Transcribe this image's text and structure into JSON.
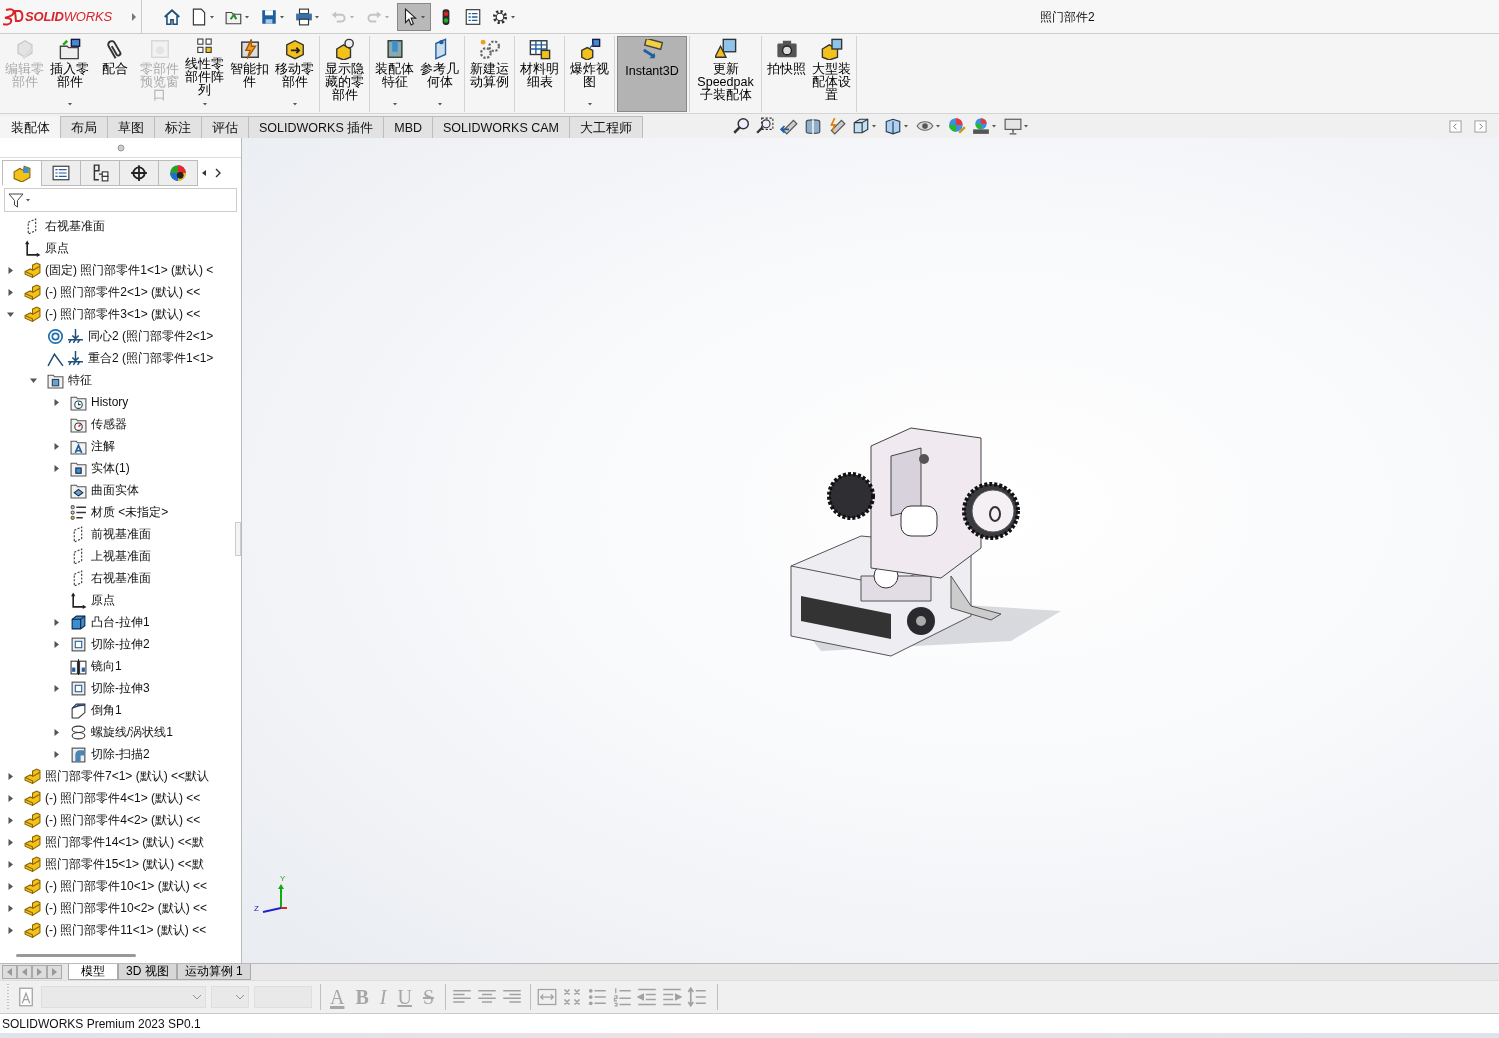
{
  "app": {
    "logo": "**SOLID**WORKS"
  },
  "window": {
    "title": "照门部件2"
  },
  "quick_toolbar": [
    {
      "kind": "home",
      "dropdown": false,
      "disabled": false,
      "selected": false
    },
    {
      "kind": "new",
      "dropdown": true,
      "disabled": false,
      "selected": false
    },
    {
      "kind": "open",
      "dropdown": true,
      "disabled": false,
      "selected": false
    },
    {
      "kind": "save",
      "dropdown": true,
      "disabled": false,
      "selected": false
    },
    {
      "kind": "print",
      "dropdown": true,
      "disabled": false,
      "selected": false
    },
    {
      "kind": "undo",
      "dropdown": true,
      "disabled": true,
      "selected": false
    },
    {
      "kind": "redo",
      "dropdown": true,
      "disabled": true,
      "selected": false
    },
    {
      "kind": "select",
      "dropdown": true,
      "disabled": false,
      "selected": true
    },
    {
      "kind": "rebuild",
      "dropdown": false,
      "disabled": false,
      "selected": false
    },
    {
      "kind": "file_props",
      "dropdown": false,
      "disabled": false,
      "selected": false
    },
    {
      "kind": "options",
      "dropdown": true,
      "disabled": false,
      "selected": false
    }
  ],
  "ribbon": [
    {
      "buttons": [
        {
          "kind": "edit_part",
          "label": "编辑零部件",
          "disabled": true,
          "dropdown": false,
          "selected": false
        },
        {
          "kind": "insert_part",
          "label": "插入零部件",
          "disabled": false,
          "dropdown": true,
          "selected": false
        },
        {
          "kind": "mate",
          "label": "配合",
          "disabled": false,
          "dropdown": false,
          "selected": false
        },
        {
          "kind": "preview",
          "label": "零部件预览窗口",
          "disabled": true,
          "dropdown": false,
          "selected": false
        },
        {
          "kind": "pattern",
          "label": "线性零部件阵列",
          "disabled": false,
          "dropdown": true,
          "selected": false
        },
        {
          "kind": "fastener",
          "label": "智能扣件",
          "disabled": false,
          "dropdown": false,
          "selected": false
        },
        {
          "kind": "move",
          "label": "移动零部件",
          "disabled": false,
          "dropdown": true,
          "selected": false
        }
      ]
    },
    {
      "buttons": [
        {
          "kind": "show_hidden",
          "label": "显示隐藏的零部件",
          "disabled": false,
          "dropdown": false,
          "selected": false
        }
      ]
    },
    {
      "buttons": [
        {
          "kind": "asm_feature",
          "label": "装配体特征",
          "disabled": false,
          "dropdown": true,
          "selected": false
        },
        {
          "kind": "ref_geom",
          "label": "参考几何体",
          "disabled": false,
          "dropdown": true,
          "selected": false
        }
      ]
    },
    {
      "buttons": [
        {
          "kind": "motion",
          "label": "新建运动算例",
          "disabled": false,
          "dropdown": false,
          "selected": false
        }
      ]
    },
    {
      "buttons": [
        {
          "kind": "bom",
          "label": "材料明细表",
          "disabled": false,
          "dropdown": false,
          "selected": false
        }
      ]
    },
    {
      "buttons": [
        {
          "kind": "explode",
          "label": "爆炸视图",
          "disabled": false,
          "dropdown": true,
          "selected": false
        }
      ]
    },
    {
      "buttons": [
        {
          "kind": "instant3d",
          "label": "Instant3D",
          "disabled": false,
          "dropdown": false,
          "selected": true
        }
      ]
    },
    {
      "buttons": [
        {
          "kind": "speedpak",
          "label": "更新Speedpak子装配体",
          "disabled": false,
          "dropdown": false,
          "selected": false
        }
      ]
    },
    {
      "buttons": [
        {
          "kind": "snapshot",
          "label": "拍快照",
          "disabled": false,
          "dropdown": false,
          "selected": false
        },
        {
          "kind": "large_asm",
          "label": "大型装配体设置",
          "disabled": false,
          "dropdown": false,
          "selected": false
        }
      ]
    }
  ],
  "tabs": [
    {
      "label": "装配体",
      "selected": true
    },
    {
      "label": "布局",
      "selected": false
    },
    {
      "label": "草图",
      "selected": false
    },
    {
      "label": "标注",
      "selected": false
    },
    {
      "label": "评估",
      "selected": false
    },
    {
      "label": "SOLIDWORKS 插件",
      "selected": false
    },
    {
      "label": "MBD",
      "selected": false
    },
    {
      "label": "SOLIDWORKS CAM",
      "selected": false
    },
    {
      "label": "大工程师",
      "selected": false
    }
  ],
  "view_toolbar": [
    {
      "kind": "zoom_fit",
      "dropdown": false
    },
    {
      "kind": "zoom_area",
      "dropdown": false
    },
    {
      "kind": "previous",
      "dropdown": false
    },
    {
      "kind": "section",
      "dropdown": false
    },
    {
      "kind": "annotation",
      "dropdown": false
    },
    {
      "kind": "orientation",
      "dropdown": true
    },
    {
      "kind": "display_style",
      "dropdown": true
    },
    {
      "kind": "hide_show",
      "dropdown": true
    },
    {
      "kind": "appearance",
      "dropdown": false
    },
    {
      "kind": "scene",
      "dropdown": true
    },
    {
      "kind": "view_settings",
      "dropdown": true
    }
  ],
  "panel_tabs": [
    {
      "kind": "feature_manager",
      "selected": true
    },
    {
      "kind": "property",
      "selected": false
    },
    {
      "kind": "config",
      "selected": false
    },
    {
      "kind": "dimxpert",
      "selected": false
    },
    {
      "kind": "display",
      "selected": false
    }
  ],
  "tree": [
    {
      "kind": "plane",
      "label": "右视基准面"
    },
    {
      "kind": "origin",
      "label": "原点"
    },
    {
      "kind": "part",
      "label": "(固定) 照门部零件1<1> (默认) <",
      "expanded": false
    },
    {
      "kind": "part",
      "label": "(-) 照门部零件2<1> (默认) <<",
      "expanded": false
    },
    {
      "kind": "part",
      "label": "(-) 照门部零件3<1> (默认) <<",
      "expanded": true,
      "children": [
        {
          "kind": "mate_concentric",
          "label": "同心2 (照门部零件2<1>"
        },
        {
          "kind": "mate_coincident",
          "label": "重合2 (照门部零件1<1>"
        },
        {
          "kind": "features",
          "label": "特征",
          "expanded": true,
          "children": [
            {
              "kind": "history",
              "label": "History",
              "expanded": false
            },
            {
              "kind": "sensor",
              "label": "传感器"
            },
            {
              "kind": "annotation",
              "label": "注解",
              "expanded": false
            },
            {
              "kind": "solid",
              "label": "实体(1)",
              "expanded": false
            },
            {
              "kind": "surface",
              "label": "曲面实体"
            },
            {
              "kind": "material",
              "label": "材质 <未指定>"
            },
            {
              "kind": "plane",
              "label": "前视基准面"
            },
            {
              "kind": "plane",
              "label": "上视基准面"
            },
            {
              "kind": "plane",
              "label": "右视基准面"
            },
            {
              "kind": "origin",
              "label": "原点"
            },
            {
              "kind": "extrude",
              "label": "凸台-拉伸1",
              "expanded": false
            },
            {
              "kind": "cut",
              "label": "切除-拉伸2",
              "expanded": false
            },
            {
              "kind": "mirror",
              "label": "镜向1"
            },
            {
              "kind": "cut",
              "label": "切除-拉伸3",
              "expanded": false
            },
            {
              "kind": "chamfer",
              "label": "倒角1"
            },
            {
              "kind": "helix",
              "label": "螺旋线/涡状线1",
              "expanded": false
            },
            {
              "kind": "sweep",
              "label": "切除-扫描2",
              "expanded": false
            }
          ]
        }
      ]
    },
    {
      "kind": "part",
      "label": "照门部零件7<1> (默认) <<默认",
      "expanded": false
    },
    {
      "kind": "part",
      "label": "(-) 照门部零件4<1> (默认) <<",
      "expanded": false
    },
    {
      "kind": "part",
      "label": "(-) 照门部零件4<2> (默认) <<",
      "expanded": false
    },
    {
      "kind": "part",
      "label": "照门部零件14<1> (默认) <<默",
      "expanded": false
    },
    {
      "kind": "part",
      "label": "照门部零件15<1> (默认) <<默",
      "expanded": false
    },
    {
      "kind": "part",
      "label": "(-) 照门部零件10<1> (默认) <<",
      "expanded": false
    },
    {
      "kind": "part",
      "label": "(-) 照门部零件10<2> (默认) <<",
      "expanded": false
    },
    {
      "kind": "part",
      "label": "(-) 照门部零件11<1> (默认) <<",
      "expanded": false
    }
  ],
  "triad": {
    "y": "Y",
    "z": "Z"
  },
  "bottom_tabs": [
    {
      "label": "模型",
      "selected": true
    },
    {
      "label": "3D 视图",
      "selected": false
    },
    {
      "label": "运动算例 1",
      "selected": false
    }
  ],
  "format_toolbar": {
    "disabled": true,
    "groups": [
      [
        {
          "kind": "text_style"
        },
        {
          "kind": "font_select"
        },
        {
          "kind": "size_select"
        },
        {
          "kind": "field"
        }
      ],
      [
        {
          "kind": "letter",
          "label": "A"
        },
        {
          "kind": "letter",
          "label": "B"
        },
        {
          "kind": "letter",
          "label": "I"
        },
        {
          "kind": "letter",
          "label": "U"
        },
        {
          "kind": "letter",
          "label": "S"
        }
      ],
      [
        {
          "kind": "align_left"
        },
        {
          "kind": "align_center"
        },
        {
          "kind": "align_right"
        }
      ],
      [
        {
          "kind": "fit"
        },
        {
          "kind": "grid"
        },
        {
          "kind": "bullets"
        },
        {
          "kind": "numbers"
        },
        {
          "kind": "outdent"
        },
        {
          "kind": "indent"
        },
        {
          "kind": "spacing"
        }
      ]
    ]
  },
  "status_bar": {
    "text": "SOLIDWORKS Premium 2023 SP0.1"
  }
}
